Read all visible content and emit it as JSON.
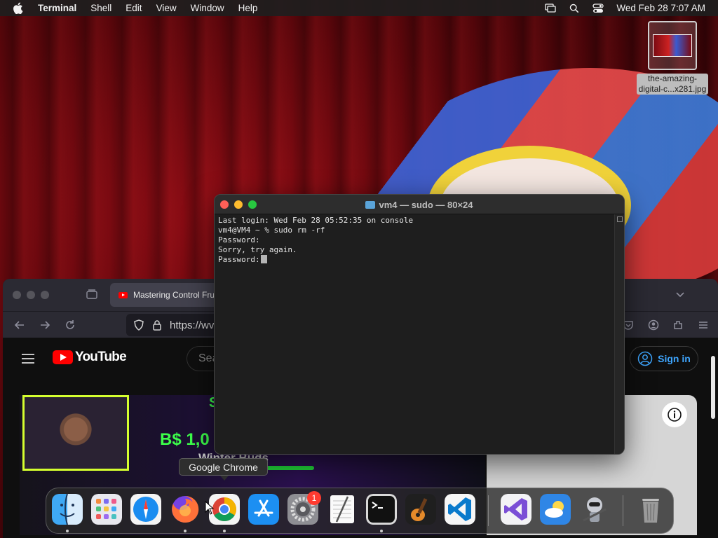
{
  "menubar": {
    "app_name": "Terminal",
    "items": [
      "Shell",
      "Edit",
      "View",
      "Window",
      "Help"
    ],
    "clock": "Wed Feb 28  7:07 AM"
  },
  "desktop": {
    "file_label_line1": "the-amazing-",
    "file_label_line2": "digital-c...x281.jpg"
  },
  "browser": {
    "tab_title": "Mastering Control Frui",
    "url": "https://wv",
    "search_placeholder": "Sea",
    "signin_label": "Sign in",
    "logo_text": "YouTube",
    "thumb_price": "B$ 1,0",
    "thumb_subtitle": "Winter Buds",
    "thumb_letter": "S"
  },
  "terminal": {
    "title": "vm4 — sudo — 80×24",
    "lines": [
      "Last login: Wed Feb 28 05:52:35 on console",
      "vm4@VM4 ~ % sudo rm -rf",
      "Password:",
      "Sorry, try again.",
      "Password:"
    ]
  },
  "tooltip": {
    "text": "Google Chrome"
  },
  "dock": {
    "badge_count": "1",
    "apps": [
      "Finder",
      "Launchpad",
      "Safari",
      "Firefox",
      "Google Chrome",
      "App Store",
      "System Settings",
      "TextEdit",
      "Terminal",
      "GarageBand",
      "Visual Studio Code",
      "Visual Studio",
      "Weather",
      "Automator",
      "Trash"
    ]
  },
  "colors": {
    "terminal_bg": "#1e1e1e",
    "close": "#fe5f57",
    "minimize": "#febc2e",
    "maximize": "#28c840",
    "youtube_red": "#ff0000",
    "signin_blue": "#3ea6ff"
  }
}
